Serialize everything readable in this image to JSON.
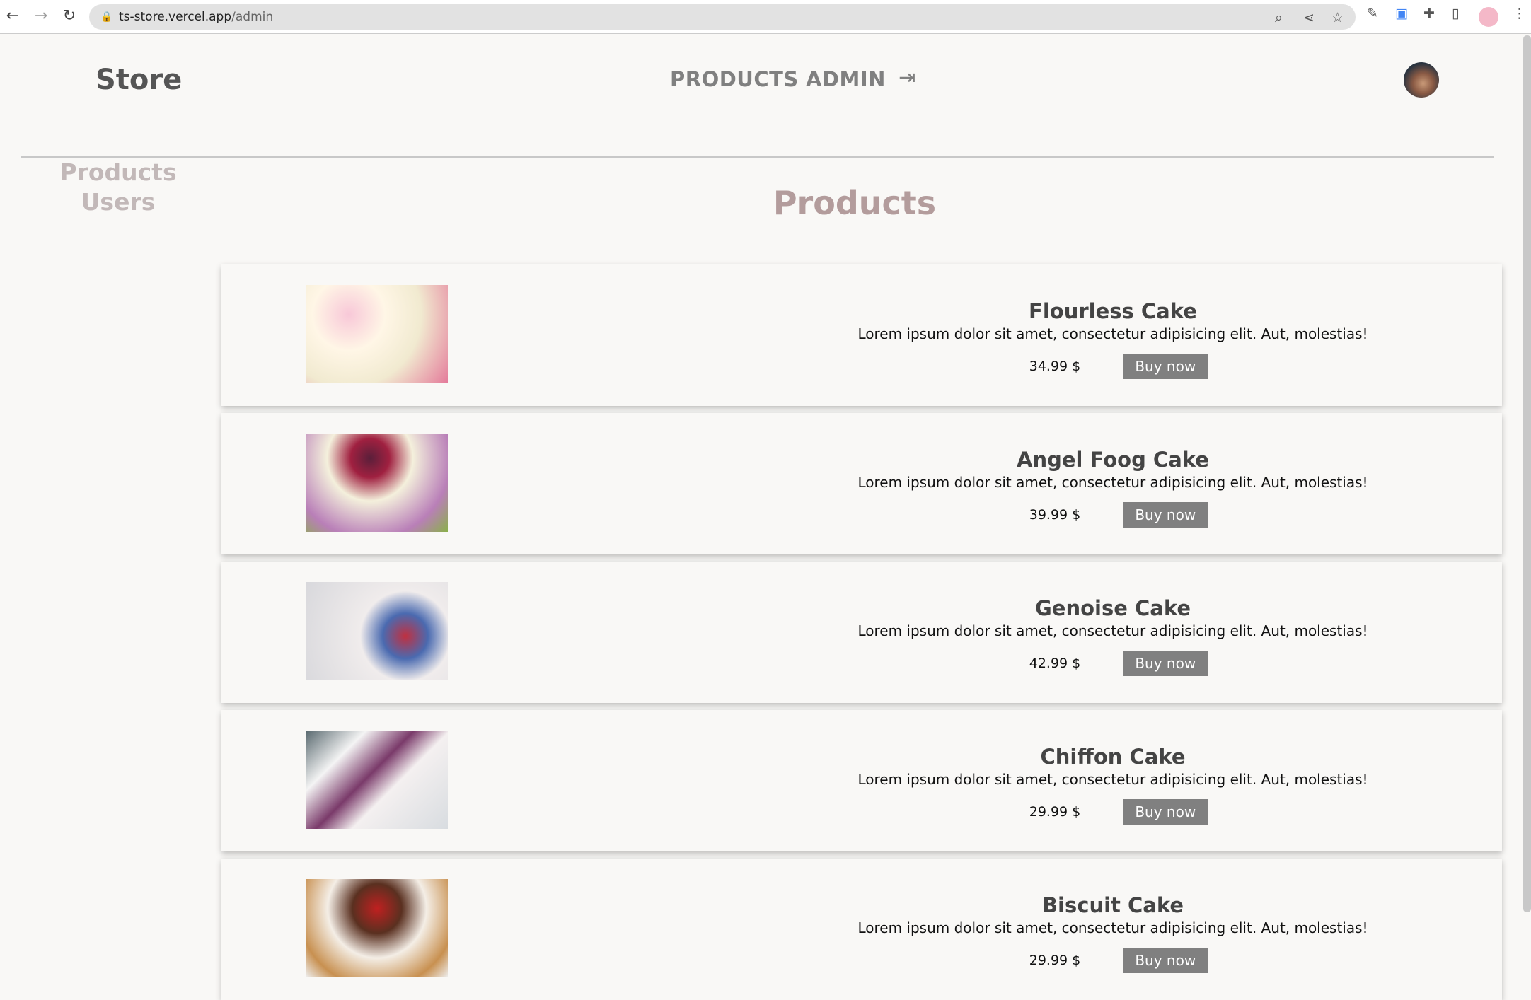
{
  "browser": {
    "url_host": "ts-store.vercel.app",
    "url_path": "/admin"
  },
  "header": {
    "brand": "Store",
    "nav": [
      "PRODUCTS",
      "ADMIN"
    ],
    "logout_icon": "logout-icon"
  },
  "sidebar": {
    "items": [
      "Products",
      "Users"
    ]
  },
  "main": {
    "title": "Products",
    "products": [
      {
        "name": "Flourless Cake",
        "description": "Lorem ipsum dolor sit amet, consectetur adipisicing elit. Aut, molestias!",
        "price": "34.99 $",
        "button": "Buy now"
      },
      {
        "name": "Angel Foog Cake",
        "description": "Lorem ipsum dolor sit amet, consectetur adipisicing elit. Aut, molestias!",
        "price": "39.99 $",
        "button": "Buy now"
      },
      {
        "name": "Genoise Cake",
        "description": "Lorem ipsum dolor sit amet, consectetur adipisicing elit. Aut, molestias!",
        "price": "42.99 $",
        "button": "Buy now"
      },
      {
        "name": "Chiffon Cake",
        "description": "Lorem ipsum dolor sit amet, consectetur adipisicing elit. Aut, molestias!",
        "price": "29.99 $",
        "button": "Buy now"
      },
      {
        "name": "Biscuit Cake",
        "description": "Lorem ipsum dolor sit amet, consectetur adipisicing elit. Aut, molestias!",
        "price": "29.99 $",
        "button": "Buy now"
      }
    ]
  },
  "colors": {
    "button": "#808080",
    "title": "#b39c9c",
    "sidebar": "#c2b8b8"
  }
}
